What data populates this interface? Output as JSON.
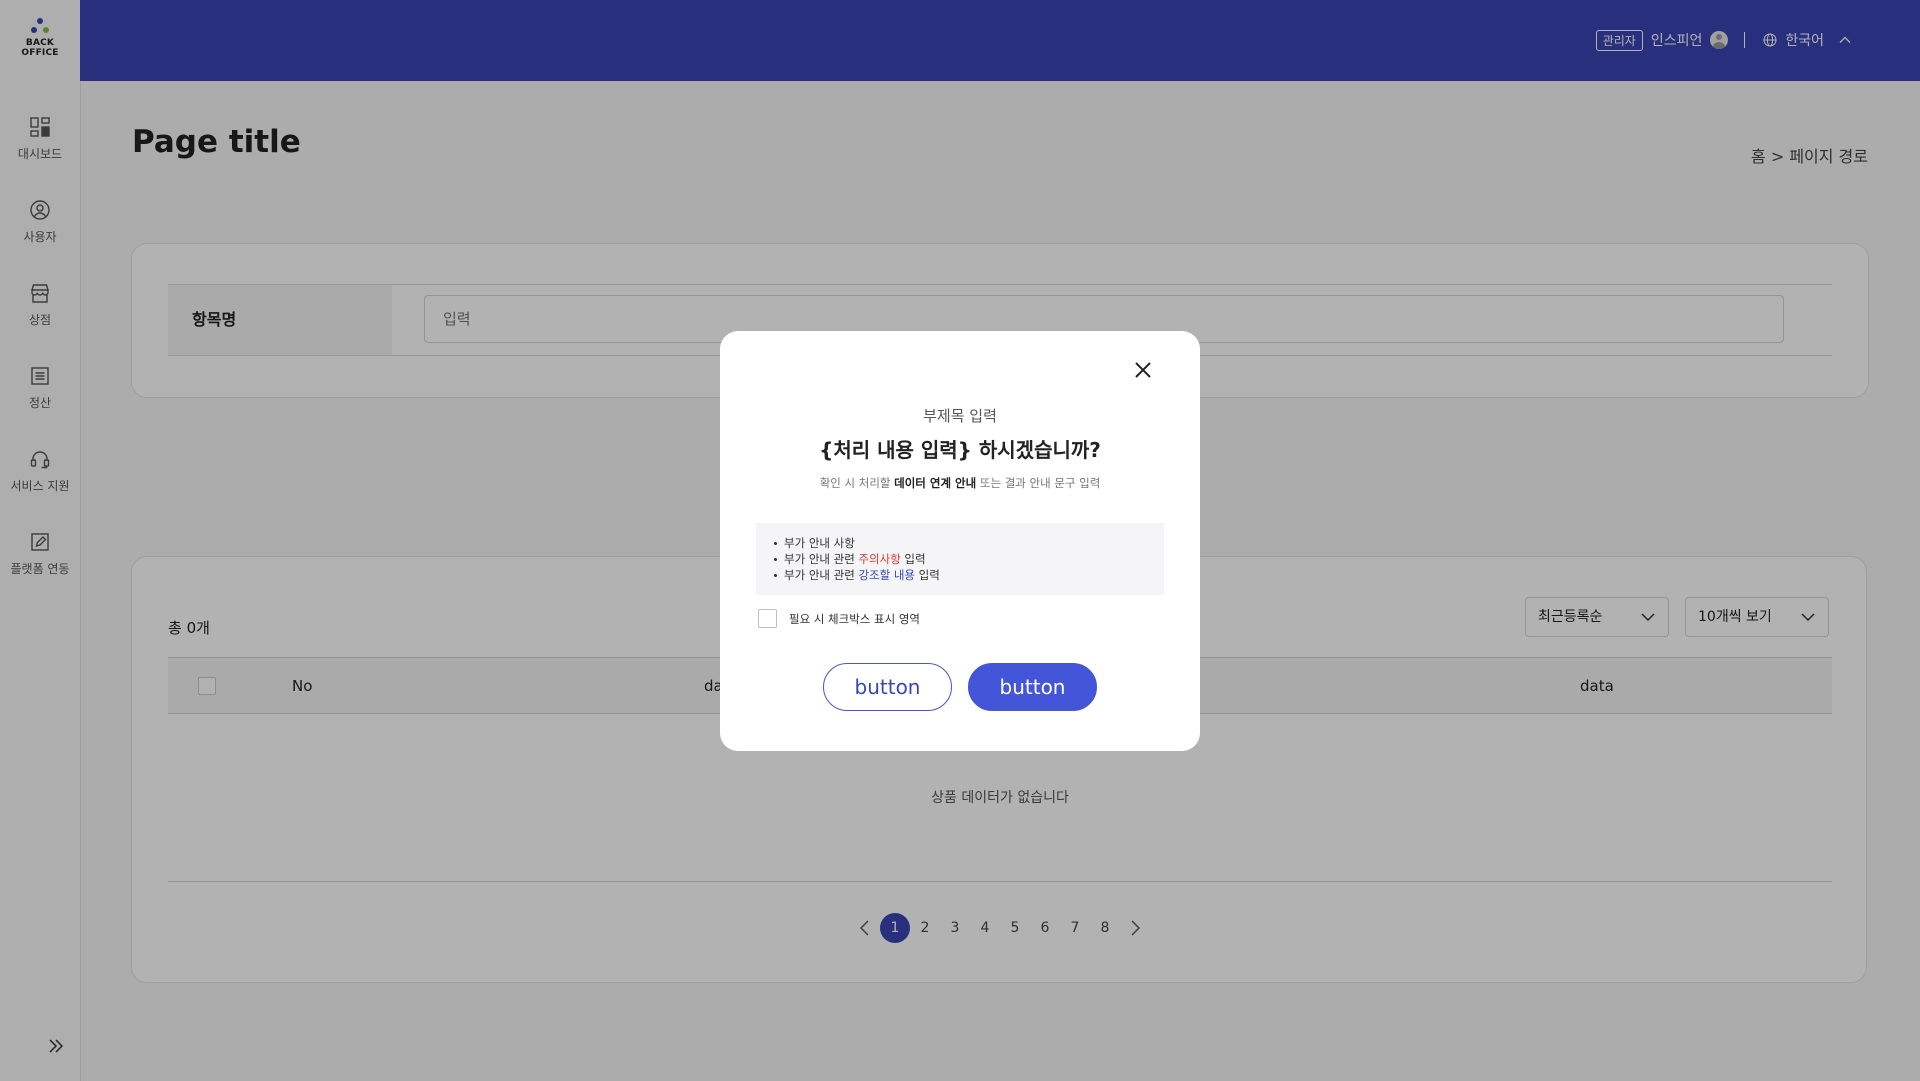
{
  "brand": {
    "logo_line1": "BACK",
    "logo_line2": "OFFICE",
    "primary": "#3a46b4"
  },
  "sidebar": {
    "items": [
      {
        "label": "대시보드",
        "icon": "dashboard-icon"
      },
      {
        "label": "사용자",
        "icon": "user-icon"
      },
      {
        "label": "상점",
        "icon": "store-icon"
      },
      {
        "label": "정산",
        "icon": "list-icon"
      },
      {
        "label": "서비스 지원",
        "icon": "headset-icon"
      },
      {
        "label": "플랫폼 연동",
        "icon": "edit-icon"
      }
    ],
    "collapse_icon": "double-chevron-right-icon"
  },
  "header": {
    "role_badge": "관리자",
    "user_name": "인스피언",
    "language": "한국어"
  },
  "page": {
    "title": "Page title",
    "breadcrumb": "홈 > 페이지 경로"
  },
  "search": {
    "label": "항목명",
    "placeholder": "입력"
  },
  "list": {
    "total": "총 0개",
    "sort_select": "최근등록순",
    "page_size_select": "10개씩 보기",
    "columns": [
      "No",
      "data",
      "data"
    ],
    "empty_message": "상품 데이터가 없습니다",
    "pages": [
      "1",
      "2",
      "3",
      "4",
      "5",
      "6",
      "7",
      "8"
    ],
    "current_page": "1"
  },
  "modal": {
    "subtitle": "부제목 입력",
    "title": "{처리 내용 입력} 하시겠습니까?",
    "desc_before": "확인 시 처리할 ",
    "desc_bold": "데이터 연계 안내",
    "desc_after": " 또는 결과 안내 문구 입력",
    "notice_1": "부가 안내 사항",
    "notice_2_before": "부가 안내 관련 ",
    "notice_2_warning": "주의사항",
    "notice_2_after": " 입력",
    "notice_3_before": "부가 안내 관련 ",
    "notice_3_emphasis": "강조할 내용",
    "notice_3_after": " 입력",
    "checkbox_label": "필요 시 체크박스 표시 영역",
    "button_secondary": "button",
    "button_primary": "button",
    "warning_color": "#e03a3a",
    "emphasis_color": "#3a46b4"
  }
}
